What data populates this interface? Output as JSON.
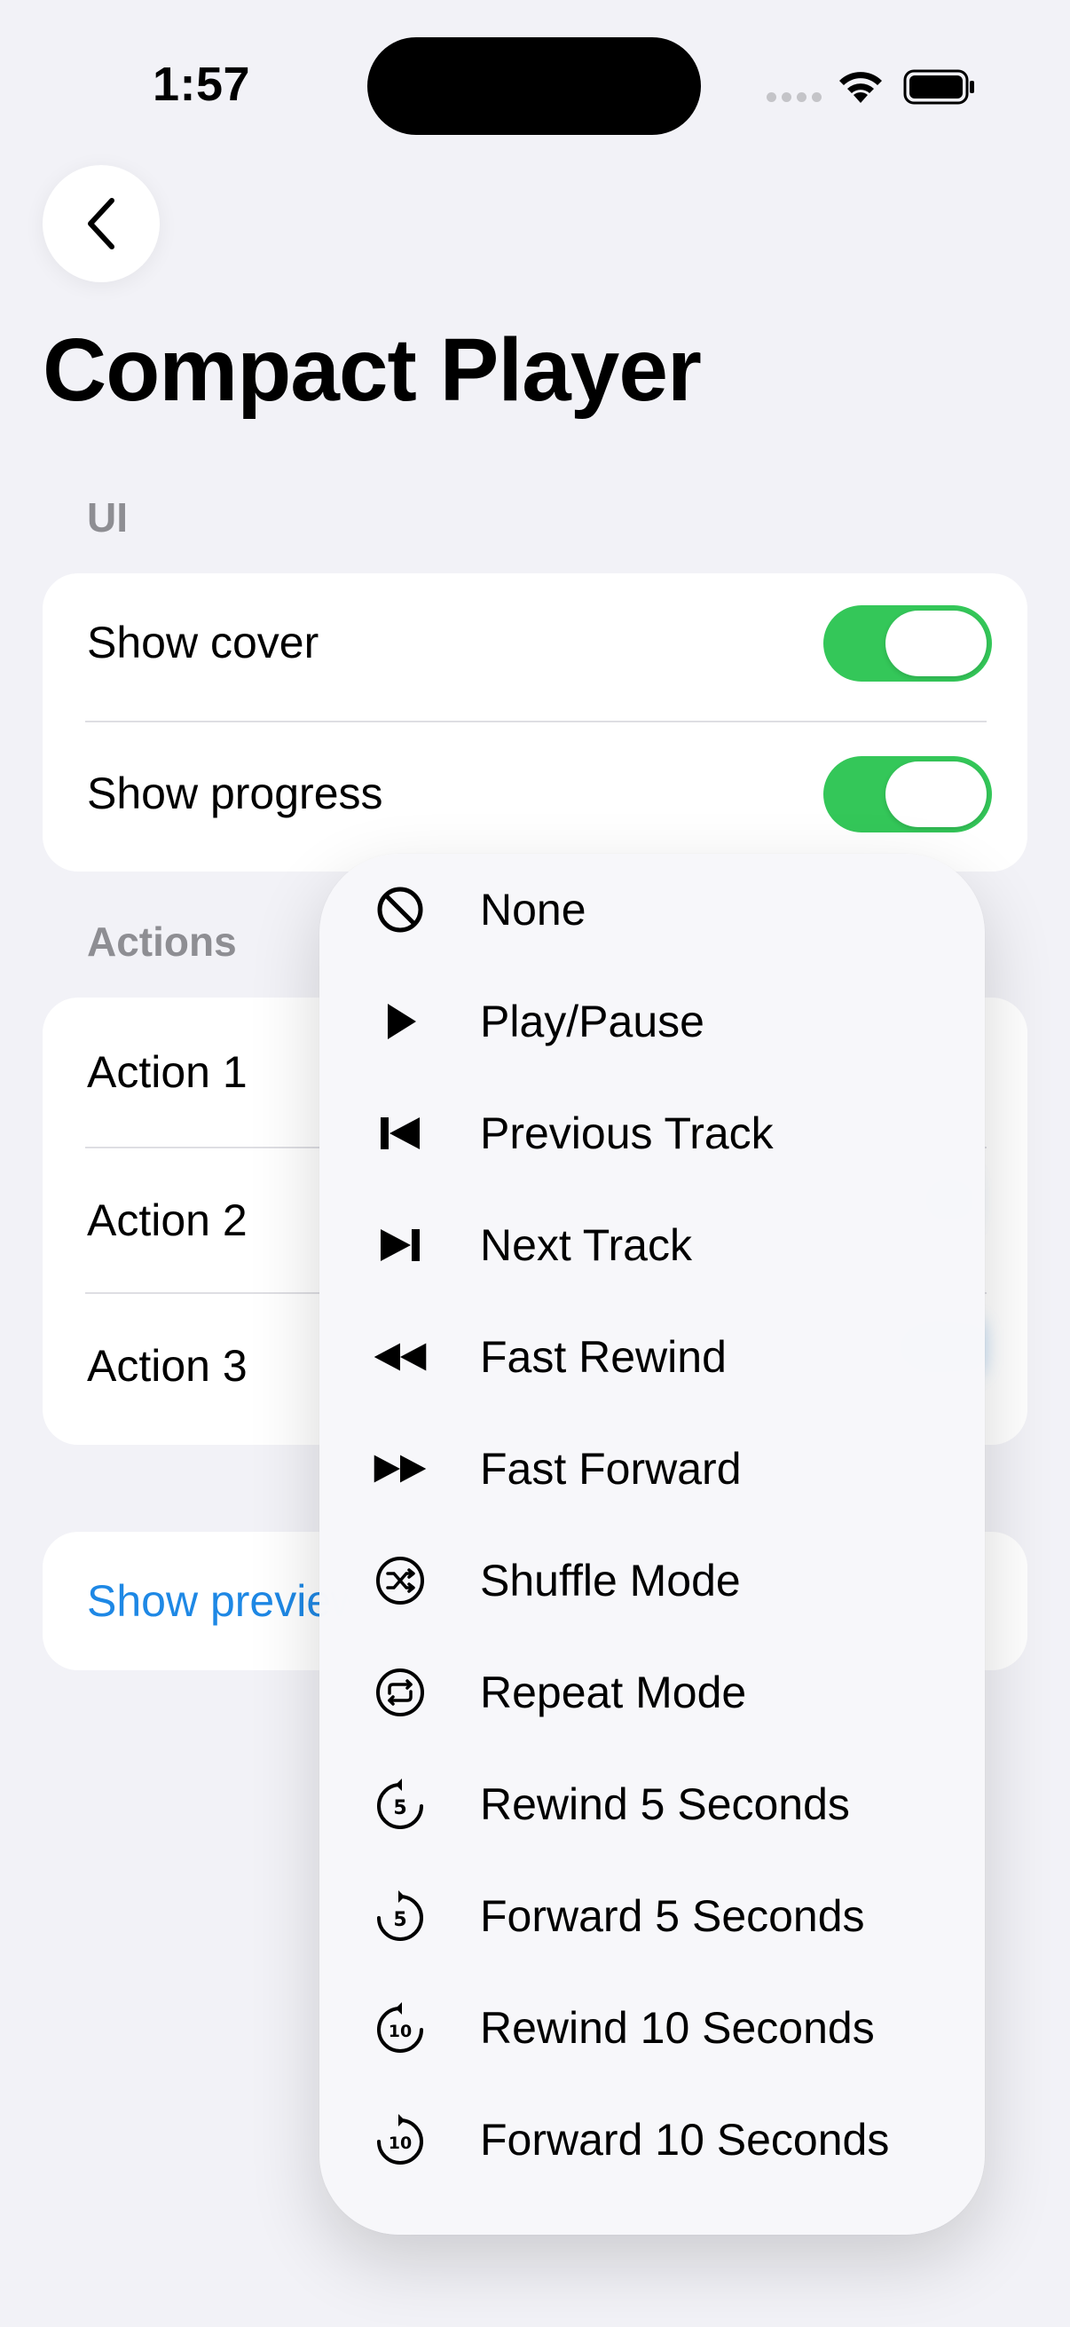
{
  "status_bar": {
    "time": "1:57"
  },
  "page": {
    "title": "Compact Player"
  },
  "ui_section": {
    "header": "UI",
    "rows": [
      {
        "label": "Show cover",
        "on": true
      },
      {
        "label": "Show progress",
        "on": true
      }
    ]
  },
  "actions_section": {
    "header": "Actions",
    "rows": [
      {
        "label": "Action 1"
      },
      {
        "label": "Action 2"
      },
      {
        "label": "Action 3"
      }
    ]
  },
  "preview": {
    "label": "Show preview"
  },
  "menu": {
    "items": [
      {
        "label": "None",
        "icon": "prohibited-icon"
      },
      {
        "label": "Play/Pause",
        "icon": "play-icon"
      },
      {
        "label": "Previous Track",
        "icon": "previous-track-icon"
      },
      {
        "label": "Next Track",
        "icon": "next-track-icon"
      },
      {
        "label": "Fast Rewind",
        "icon": "rewind-icon"
      },
      {
        "label": "Fast Forward",
        "icon": "fast-forward-icon"
      },
      {
        "label": "Shuffle Mode",
        "icon": "shuffle-icon"
      },
      {
        "label": "Repeat Mode",
        "icon": "repeat-icon"
      },
      {
        "label": "Rewind 5 Seconds",
        "icon": "rewind-5-icon"
      },
      {
        "label": "Forward 5 Seconds",
        "icon": "forward-5-icon"
      },
      {
        "label": "Rewind 10 Seconds",
        "icon": "rewind-10-icon"
      },
      {
        "label": "Forward 10 Seconds",
        "icon": "forward-10-icon"
      }
    ]
  },
  "colors": {
    "accent": "#1E88E5",
    "toggle_on": "#34C759",
    "background": "#F2F2F7"
  }
}
